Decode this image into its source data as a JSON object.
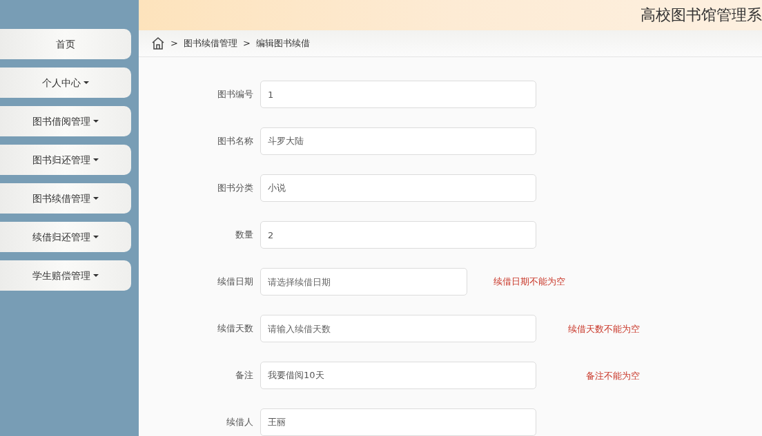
{
  "sidebar": {
    "items": [
      {
        "label": "首页",
        "has_menu": false
      },
      {
        "label": "个人中心",
        "has_menu": true
      },
      {
        "label": "图书借阅管理",
        "has_menu": true
      },
      {
        "label": "图书归还管理",
        "has_menu": true
      },
      {
        "label": "图书续借管理",
        "has_menu": true
      },
      {
        "label": "续借归还管理",
        "has_menu": true
      },
      {
        "label": "学生赔偿管理",
        "has_menu": true
      }
    ]
  },
  "header": {
    "title": "高校图书馆管理系"
  },
  "breadcrumb": [
    {
      "separator": ">",
      "label": "图书续借管理"
    },
    {
      "separator": ">",
      "label": "编辑图书续借"
    }
  ],
  "form": {
    "fields": [
      {
        "label": "图书编号",
        "kind": "text",
        "value": "1"
      },
      {
        "label": "图书名称",
        "kind": "text",
        "value": "斗罗大陆"
      },
      {
        "label": "图书分类",
        "kind": "text",
        "value": "小说"
      },
      {
        "label": "数量",
        "kind": "text",
        "value": "2"
      },
      {
        "label": "续借日期",
        "kind": "date",
        "placeholder": "请选择续借日期",
        "error": "续借日期不能为空"
      },
      {
        "label": "续借天数",
        "kind": "text",
        "placeholder": "请输入续借天数",
        "error": "续借天数不能为空"
      },
      {
        "label": "备注",
        "kind": "text",
        "value": "我要借阅10天",
        "error": "备注不能为空"
      },
      {
        "label": "续借人",
        "kind": "text",
        "value": "王丽"
      }
    ]
  }
}
